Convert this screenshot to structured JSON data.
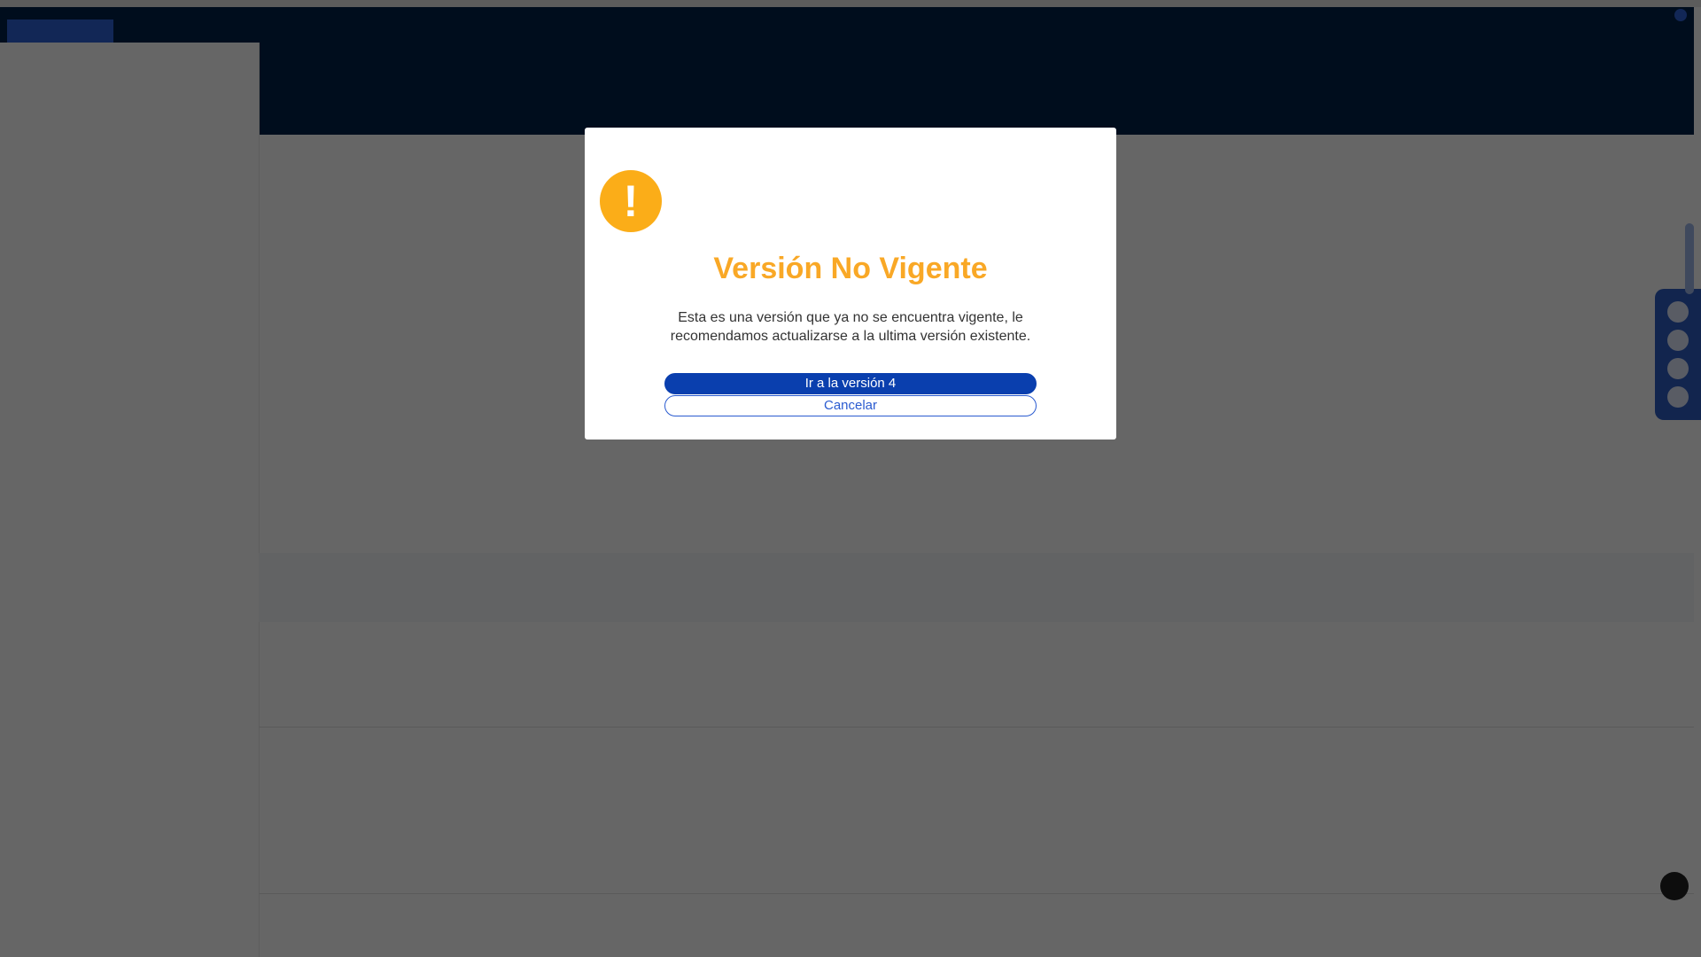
{
  "modal": {
    "title": "Versión No Vigente",
    "message": "Esta es una versión que ya no se encuentra vigente, le recomendamos actualizarse a la ultima versión existente.",
    "primary_button": "Ir a la versión 4",
    "secondary_button": "Cancelar",
    "icon": "exclamation-icon",
    "icon_glyph": "!",
    "colors": {
      "icon": "#fbad18",
      "title": "#f9a826",
      "primary": "#0a3fae"
    }
  },
  "colors": {
    "header": "#00224a",
    "overlay": "rgba(0,0,0,0.6)"
  }
}
